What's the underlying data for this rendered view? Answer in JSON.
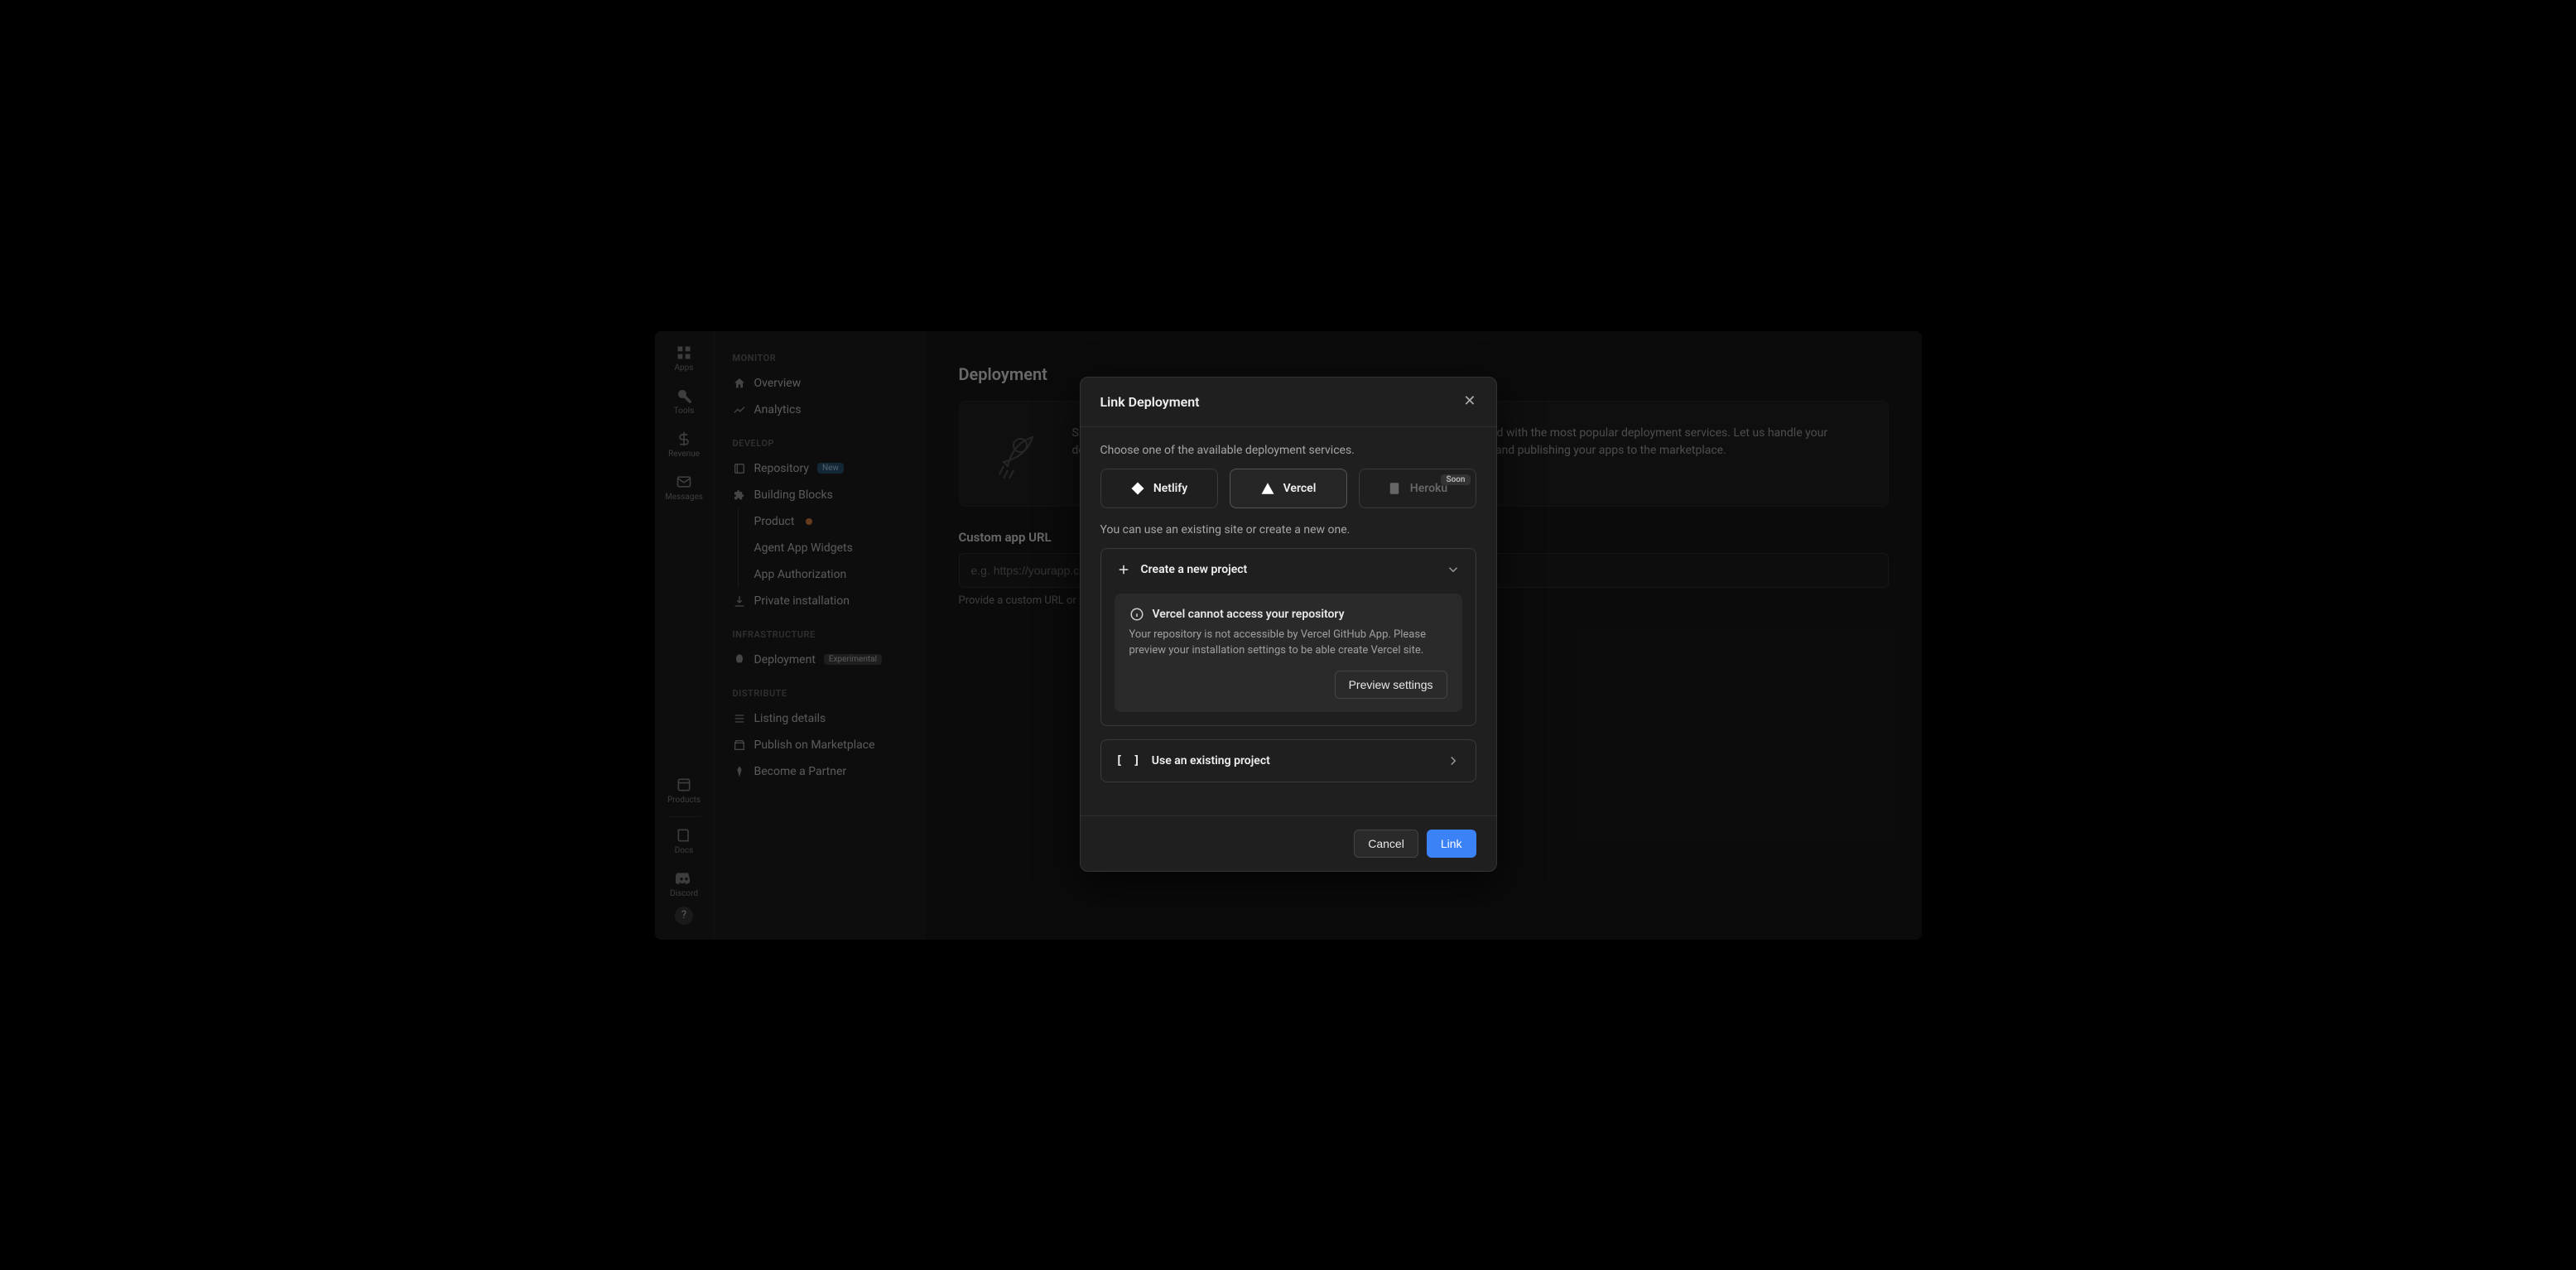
{
  "rail": {
    "apps": "Apps",
    "tools": "Tools",
    "revenue": "Revenue",
    "messages": "Messages",
    "products": "Products",
    "docs": "Docs",
    "discord": "Discord"
  },
  "sidebar": {
    "monitor": "MONITOR",
    "overview": "Overview",
    "analytics": "Analytics",
    "develop": "DEVELOP",
    "repository": "Repository",
    "repo_badge": "New",
    "building_blocks": "Building Blocks",
    "product": "Product",
    "agent_widgets": "Agent App Widgets",
    "app_auth": "App Authorization",
    "private_install": "Private installation",
    "infrastructure": "INFRASTRUCTURE",
    "deployment": "Deployment",
    "deploy_badge": "Experimental",
    "distribute": "DISTRIBUTE",
    "listing": "Listing details",
    "publish": "Publish on Marketplace",
    "partner": "Become a Partner"
  },
  "main": {
    "title": "Deployment",
    "hero": "Smoothly deploy & manage your livechat apps with our advanced tooling, connected with the most popular deployment services. Let us handle your deployments, enabling you to concentrate on fast and reliable development cycles and publishing your apps to the marketplace.",
    "custom_url": "Custom app URL",
    "url_placeholder": "e.g. https://yourapp.com",
    "url_helper": "Provide a custom URL or link deployment to generate app URL."
  },
  "modal": {
    "title": "Link Deployment",
    "choose": "Choose one of the available deployment services.",
    "netlify": "Netlify",
    "vercel": "Vercel",
    "heroku": "Heroku",
    "soon": "Soon",
    "existing_hint": "You can use an existing site or create a new one.",
    "create_new": "Create a new project",
    "warn_title": "Vercel cannot access your repository",
    "warn_body": "Your repository is not accessible by Vercel GitHub App. Please preview your installation settings to be able create Vercel site.",
    "preview_btn": "Preview settings",
    "use_existing": "Use an existing project",
    "cancel": "Cancel",
    "link": "Link"
  }
}
